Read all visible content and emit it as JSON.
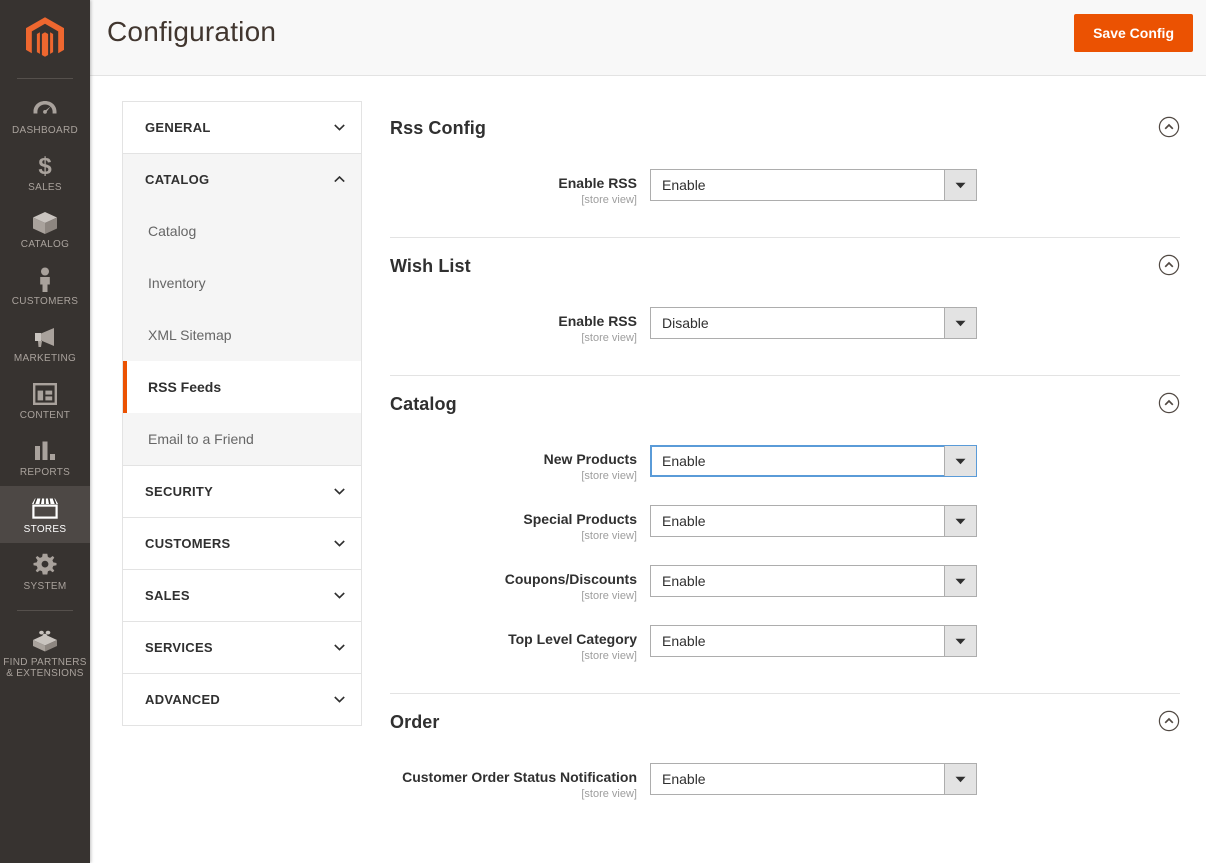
{
  "admin_nav": {
    "logo_name": "magento-logo",
    "items": [
      {
        "label": "Dashboard",
        "icon": "dashboard-icon",
        "active": false
      },
      {
        "label": "Sales",
        "icon": "dollar-icon",
        "active": false
      },
      {
        "label": "Catalog",
        "icon": "box-icon",
        "active": false
      },
      {
        "label": "Customers",
        "icon": "person-icon",
        "active": false
      },
      {
        "label": "Marketing",
        "icon": "megaphone-icon",
        "active": false
      },
      {
        "label": "Content",
        "icon": "layout-icon",
        "active": false
      },
      {
        "label": "Reports",
        "icon": "bar-chart-icon",
        "active": false
      },
      {
        "label": "Stores",
        "icon": "storefront-icon",
        "active": true
      },
      {
        "label": "System",
        "icon": "gear-icon",
        "active": false
      },
      {
        "label": "Find Partners\n& Extensions",
        "icon": "extension-icon",
        "active": false
      }
    ],
    "find_partners_line1": "Find Partners",
    "find_partners_line2": "& Extensions"
  },
  "header": {
    "title": "Configuration",
    "save_label": "Save Config",
    "accent_color": "#eb5202"
  },
  "config_menu": {
    "sections": [
      {
        "label": "General",
        "expanded": false,
        "children": []
      },
      {
        "label": "Catalog",
        "expanded": true,
        "children": [
          {
            "label": "Catalog",
            "active": false
          },
          {
            "label": "Inventory",
            "active": false
          },
          {
            "label": "XML Sitemap",
            "active": false
          },
          {
            "label": "RSS Feeds",
            "active": true
          },
          {
            "label": "Email to a Friend",
            "active": false
          }
        ]
      },
      {
        "label": "Security",
        "expanded": false,
        "children": []
      },
      {
        "label": "Customers",
        "expanded": false,
        "children": []
      },
      {
        "label": "Sales",
        "expanded": false,
        "children": []
      },
      {
        "label": "Services",
        "expanded": false,
        "children": []
      },
      {
        "label": "Advanced",
        "expanded": false,
        "children": []
      }
    ]
  },
  "content": {
    "scope_label": "[store view]",
    "fieldsets": [
      {
        "title": "Rss Config",
        "collapsed": false,
        "fields": [
          {
            "label": "Enable RSS",
            "scope": "[store view]",
            "value": "Enable",
            "focused": false
          }
        ]
      },
      {
        "title": "Wish List",
        "collapsed": false,
        "fields": [
          {
            "label": "Enable RSS",
            "scope": "[store view]",
            "value": "Disable",
            "focused": false
          }
        ]
      },
      {
        "title": "Catalog",
        "collapsed": false,
        "fields": [
          {
            "label": "New Products",
            "scope": "[store view]",
            "value": "Enable",
            "focused": true
          },
          {
            "label": "Special Products",
            "scope": "[store view]",
            "value": "Enable",
            "focused": false
          },
          {
            "label": "Coupons/Discounts",
            "scope": "[store view]",
            "value": "Enable",
            "focused": false
          },
          {
            "label": "Top Level Category",
            "scope": "[store view]",
            "value": "Enable",
            "focused": false
          }
        ]
      },
      {
        "title": "Order",
        "collapsed": false,
        "fields": [
          {
            "label": "Customer Order Status Notification",
            "scope": "[store view]",
            "value": "Enable",
            "focused": false
          }
        ]
      }
    ]
  }
}
